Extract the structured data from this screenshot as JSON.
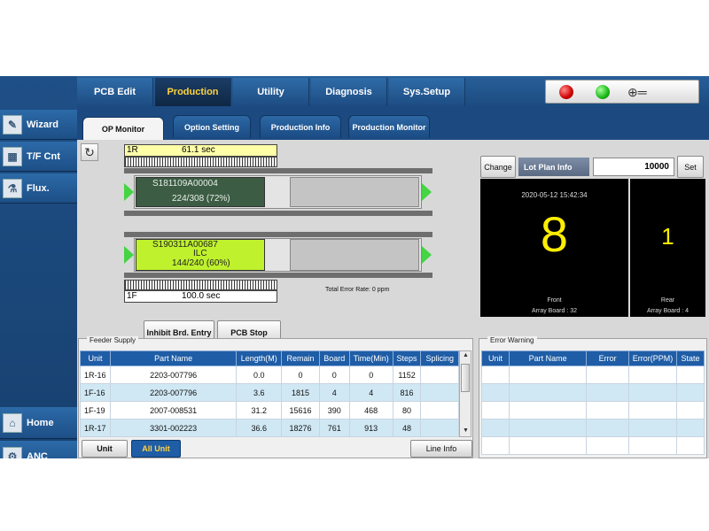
{
  "sidebar": {
    "items": [
      {
        "label": "Wizard",
        "icon": "wand-icon"
      },
      {
        "label": "T/F Cnt",
        "icon": "grid-icon"
      },
      {
        "label": "Flux.",
        "icon": "flux-icon"
      },
      {
        "label": "Home",
        "icon": "home-icon"
      },
      {
        "label": "ANC",
        "icon": "anc-icon"
      }
    ]
  },
  "topnav": {
    "tabs": [
      "PCB Edit",
      "Production",
      "Utility",
      "Diagnosis",
      "Sys.Setup"
    ],
    "active": "Production"
  },
  "subtabs": {
    "tabs": [
      "OP Monitor",
      "Option Setting",
      "Production Info",
      "Production Monitor"
    ],
    "active": "OP Monitor"
  },
  "conveyor": {
    "rear": {
      "lane": "1R",
      "time": "61.1 sec",
      "board_id": "S181109A00004",
      "progress_text": "224/308 (72%)",
      "progress": 0.72
    },
    "front": {
      "lane": "1F",
      "time": "100.0 sec",
      "board_id": "S190311A00687",
      "board_sub": "ILC",
      "progress_text": "144/240 (60%)",
      "progress": 0.6
    },
    "error_rate": "Total Error Rate: 0 ppm"
  },
  "actions": {
    "inhibit": "Inhibit Brd. Entry",
    "stop": "PCB Stop"
  },
  "lot_plan": {
    "change_label": "Change",
    "label": "Lot Plan Info",
    "value": "10000",
    "set_label": "Set"
  },
  "counter": {
    "datetime": "2020-05-12 15:42:34",
    "front": {
      "value": "8",
      "label": "Front",
      "array": "Array Board : 32"
    },
    "rear": {
      "value": "1",
      "label": "Rear",
      "array": "Array Board : 4"
    }
  },
  "feeder": {
    "title": "Feeder Supply",
    "columns": [
      "Unit",
      "Part Name",
      "Length(M)",
      "Remain",
      "Board",
      "Time(Min)",
      "Steps",
      "Splicing"
    ],
    "rows": [
      [
        "1R-16",
        "2203-007796",
        "0.0",
        "0",
        "0",
        "0",
        "1152",
        ""
      ],
      [
        "1F-16",
        "2203-007796",
        "3.6",
        "1815",
        "4",
        "4",
        "816",
        ""
      ],
      [
        "1F-19",
        "2007-008531",
        "31.2",
        "15616",
        "390",
        "468",
        "80",
        ""
      ],
      [
        "1R-17",
        "3301-002223",
        "36.6",
        "18276",
        "761",
        "913",
        "48",
        ""
      ]
    ],
    "buttons": {
      "unit": "Unit",
      "all_unit": "All Unit",
      "line_info": "Line Info"
    }
  },
  "error_warning": {
    "title": "Error Warning",
    "columns": [
      "Unit",
      "Part Name",
      "Error",
      "Error(PPM)",
      "State"
    ],
    "empty_rows": 5
  },
  "colors": {
    "accent": "#1f5da6",
    "active_tab_text": "#ffd23f",
    "counter_digits": "#ffee00",
    "board_lime": "#bff12d"
  }
}
